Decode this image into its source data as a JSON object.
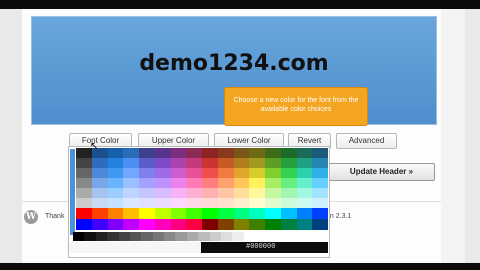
{
  "header": {
    "preview_title": "demo1234.com"
  },
  "tooltip": {
    "text": "Choose a new color for the font from the available color choices"
  },
  "toolbar": {
    "font_color": "Font Color",
    "upper_color": "Upper Color",
    "lower_color": "Lower Color",
    "revert": "Revert",
    "advanced": "Advanced"
  },
  "update_button": "Update Header »",
  "footer": {
    "left": "Thank",
    "right": "on 2.3.1"
  },
  "picker": {
    "hex_value": "#000000",
    "palette_top": [
      "#222222",
      "#1b4f8d",
      "#1560a8",
      "#2a6bb8",
      "#3d3f8f",
      "#5a338c",
      "#7e2e7e",
      "#8b2a55",
      "#8d2424",
      "#8a3a1c",
      "#7a5518",
      "#6e6a14",
      "#3e6b18",
      "#1d6b2b",
      "#1a6a5a",
      "#1c5a7a",
      "#444444",
      "#2f6cc0",
      "#2381e0",
      "#4d8ff0",
      "#5c5ccc",
      "#7f4acb",
      "#ad43ad",
      "#c43a7a",
      "#cc3333",
      "#c95a26",
      "#b07e1f",
      "#a29a1e",
      "#5e9e22",
      "#26a03d",
      "#22a085",
      "#2486b1",
      "#666666",
      "#4e88d8",
      "#3d99f2",
      "#73a7ff",
      "#7f7fee",
      "#9e6ae6",
      "#cf5ccf",
      "#e65199",
      "#f24d4d",
      "#f07a3f",
      "#e0a52a",
      "#d6cc2a",
      "#7fd02c",
      "#33d152",
      "#2ccfae",
      "#30b0e6",
      "#888888",
      "#79a6e6",
      "#6ab4ff",
      "#9bc0ff",
      "#a3a3ff",
      "#bd92ff",
      "#ec82ec",
      "#ff7bb5",
      "#ff7f7f",
      "#ffa06f",
      "#ffc65a",
      "#fff15a",
      "#a6ef62",
      "#66ef7f",
      "#66efcb",
      "#66d0ff",
      "#aaaaaa",
      "#a4c3f0",
      "#9bcdff",
      "#bed6ff",
      "#c6c6ff",
      "#d7bbff",
      "#f8b0f8",
      "#ffb0d2",
      "#ffb0b0",
      "#ffc5a6",
      "#ffdd9b",
      "#fff89b",
      "#c8f7a1",
      "#a1f7b2",
      "#a1f7e0",
      "#a1e4ff",
      "#cccccc",
      "#c6daf6",
      "#c4e2ff",
      "#dae8ff",
      "#e0e0ff",
      "#ebdcff",
      "#fdd8fd",
      "#ffd8e8",
      "#ffd8d8",
      "#ffe0cf",
      "#ffeecc",
      "#fffbcc",
      "#e2fbce",
      "#cefbd8",
      "#cefbef",
      "#cef1ff"
    ],
    "palette_mid": [
      "#ff0000",
      "#ff4000",
      "#ff8000",
      "#ffbf00",
      "#ffff00",
      "#bfff00",
      "#80ff00",
      "#40ff00",
      "#00ff00",
      "#00ff40",
      "#00ff80",
      "#00ffbf",
      "#00ffff",
      "#00bfff",
      "#0080ff",
      "#0040ff",
      "#0000ff",
      "#4000ff",
      "#8000ff",
      "#bf00ff",
      "#ff00ff",
      "#ff00bf",
      "#ff0080",
      "#ff0040",
      "#800000",
      "#804000",
      "#808000",
      "#408000",
      "#008000",
      "#008040",
      "#008080",
      "#004080"
    ],
    "palette_gray": [
      "#000000",
      "#111111",
      "#222222",
      "#333333",
      "#444444",
      "#555555",
      "#666666",
      "#777777",
      "#888888",
      "#999999",
      "#aaaaaa",
      "#bbbbbb",
      "#cccccc",
      "#dddddd",
      "#eeeeee",
      "#ffffff"
    ]
  },
  "colors": {
    "preview_bg": "#5b9bd8",
    "tooltip_bg": "#f4a521",
    "accent": "#4d92d8"
  }
}
